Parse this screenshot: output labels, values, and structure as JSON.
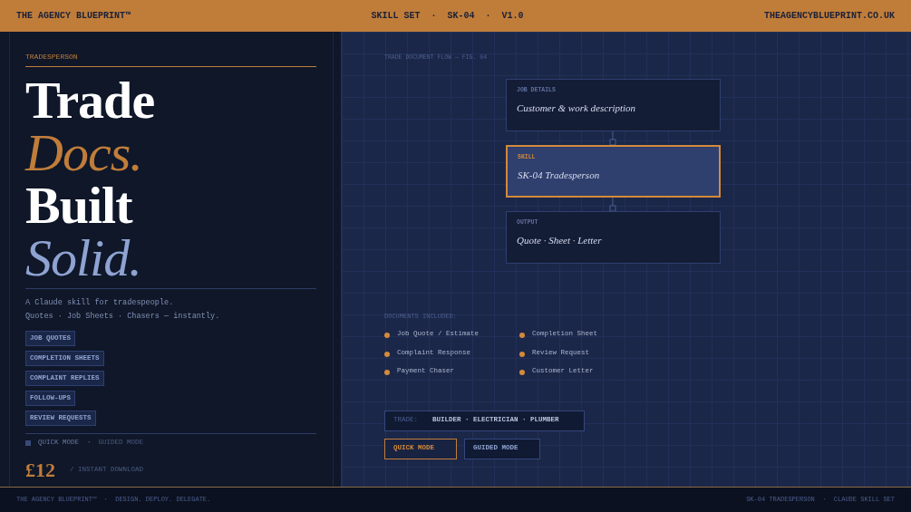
{
  "top_bar": {
    "brand": "THE AGENCY BLUEPRINT™",
    "center": "SKILL SET  ·  SK-04  ·  V1.0",
    "site": "THEAGENCYBLUEPRINT.CO.UK"
  },
  "left": {
    "eyebrow": "TRADESPERSON",
    "headline": [
      {
        "text": "Trade",
        "kind": "plain"
      },
      {
        "text": "Docs.",
        "kind": "accent"
      },
      {
        "text": "Built",
        "kind": "plain"
      },
      {
        "text": "Solid.",
        "kind": "soft"
      }
    ],
    "description": [
      "A Claude skill for tradespeople.",
      "Quotes · Job Sheets · Chasers — instantly."
    ],
    "tags": [
      "JOB QUOTES",
      "COMPLETION SHEETS",
      "COMPLAINT REPLIES",
      "FOLLOW-UPS",
      "REVIEW REQUESTS"
    ],
    "modes": [
      {
        "label": "QUICK MODE  ·",
        "selected": true
      },
      {
        "label": "GUIDED MODE",
        "selected": false
      }
    ],
    "price": "£12",
    "price_note": "/ INSTANT DOWNLOAD"
  },
  "diagram": {
    "caption": "TRADE DOCUMENT FLOW — FIG. 04",
    "nodes": [
      {
        "label": "JOB DETAILS",
        "text": "Customer & work description",
        "selected": false
      },
      {
        "label": "SKILL",
        "text": "SK-04 Tradesperson",
        "selected": true
      },
      {
        "label": "OUTPUT",
        "text": "Quote · Sheet · Letter",
        "selected": false
      }
    ]
  },
  "documents": {
    "title": "DOCUMENTS INCLUDED:",
    "items": [
      "Job Quote / Estimate",
      "Completion Sheet",
      "Complaint Response",
      "Review Request",
      "Payment Chaser",
      "Customer Letter"
    ]
  },
  "trade": {
    "label": "TRADE:",
    "value": "BUILDER · ELECTRICIAN · PLUMBER"
  },
  "mode_buttons": [
    {
      "label": "QUICK MODE",
      "selected": true
    },
    {
      "label": "GUIDED MODE",
      "selected": false
    }
  ],
  "footer": {
    "left": "THE AGENCY BLUEPRINT™  ·  DESIGN. DEPLOY. DELEGATE.",
    "right": "SK-04 TRADESPERSON  ·  CLAUDE SKILL SET"
  }
}
